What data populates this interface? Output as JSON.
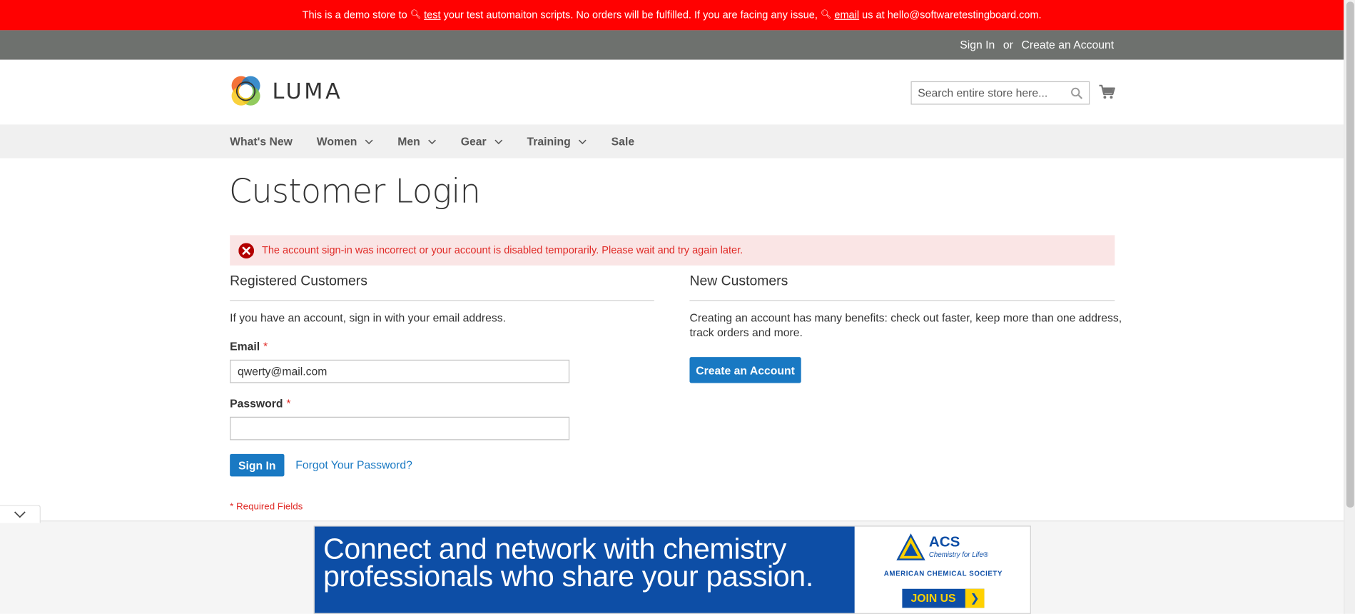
{
  "demo_notice": {
    "part1": "This is a demo store to",
    "link1": "test",
    "part2": "your test automaiton scripts. No orders will be fulfilled. If you are facing any issue,",
    "link2": "email",
    "part3": "us at hello@softwaretestingboard.com."
  },
  "header_links": {
    "sign_in": "Sign In",
    "or": "or",
    "create_account": "Create an Account"
  },
  "logo": {
    "text": "LUMA"
  },
  "search": {
    "placeholder": "Search entire store here..."
  },
  "nav": {
    "items": [
      {
        "label": "What's New"
      },
      {
        "label": "Women"
      },
      {
        "label": "Men"
      },
      {
        "label": "Gear"
      },
      {
        "label": "Training"
      },
      {
        "label": "Sale"
      }
    ]
  },
  "page": {
    "title": "Customer Login",
    "error_message": "The account sign-in was incorrect or your account is disabled temporarily. Please wait and try again later."
  },
  "registered": {
    "title": "Registered Customers",
    "intro": "If you have an account, sign in with your email address.",
    "email_label": "Email",
    "email_value": "qwerty@mail.com",
    "password_label": "Password",
    "password_value": "",
    "required_marker": "*",
    "sign_in_button": "Sign In",
    "forgot_link": "Forgot Your Password?",
    "required_note": "* Required Fields"
  },
  "new_customers": {
    "title": "New Customers",
    "line1": "Creating an account has many benefits: check out faster, keep more than one address,",
    "line2": "track orders and more.",
    "create_button": "Create an Account"
  },
  "ad": {
    "headline_line1": "Connect and network with chemistry",
    "headline_line2": "professionals who share your passion.",
    "brand": "ACS",
    "tagline": "Chemistry for Life®",
    "org_name": "AMERICAN CHEMICAL SOCIETY",
    "cta": "JOIN US",
    "cta_arrow": "❯"
  },
  "colors": {
    "demo_bar": "#ff0101",
    "header_panel": "#6e716e",
    "primary_button": "#1979c3",
    "error_text": "#e02b27",
    "error_bg": "#fae5e5",
    "ad_blue": "#0d4ea6"
  }
}
